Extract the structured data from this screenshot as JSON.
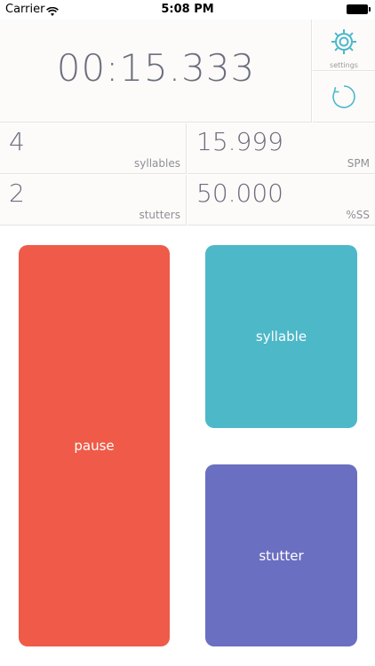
{
  "status_bar": {
    "carrier": "Carrier",
    "time": "5:08 PM"
  },
  "timer": {
    "display": "00:15.333"
  },
  "settings": {
    "label": "settings",
    "icon": "gear-icon"
  },
  "reset": {
    "icon": "reset-icon"
  },
  "stats": {
    "syllables": {
      "value": "4",
      "label": "syllables"
    },
    "spm": {
      "value": "15.999",
      "label": "SPM"
    },
    "stutters": {
      "value": "2",
      "label": "stutters"
    },
    "percent_ss": {
      "value": "50.000",
      "label": "%SS"
    }
  },
  "buttons": {
    "pause": "pause",
    "syllable": "syllable",
    "stutter": "stutter"
  },
  "colors": {
    "pause": "#ef5b48",
    "syllable": "#4db8c8",
    "stutter": "#6b6fc1",
    "accent": "#4db8c8"
  }
}
